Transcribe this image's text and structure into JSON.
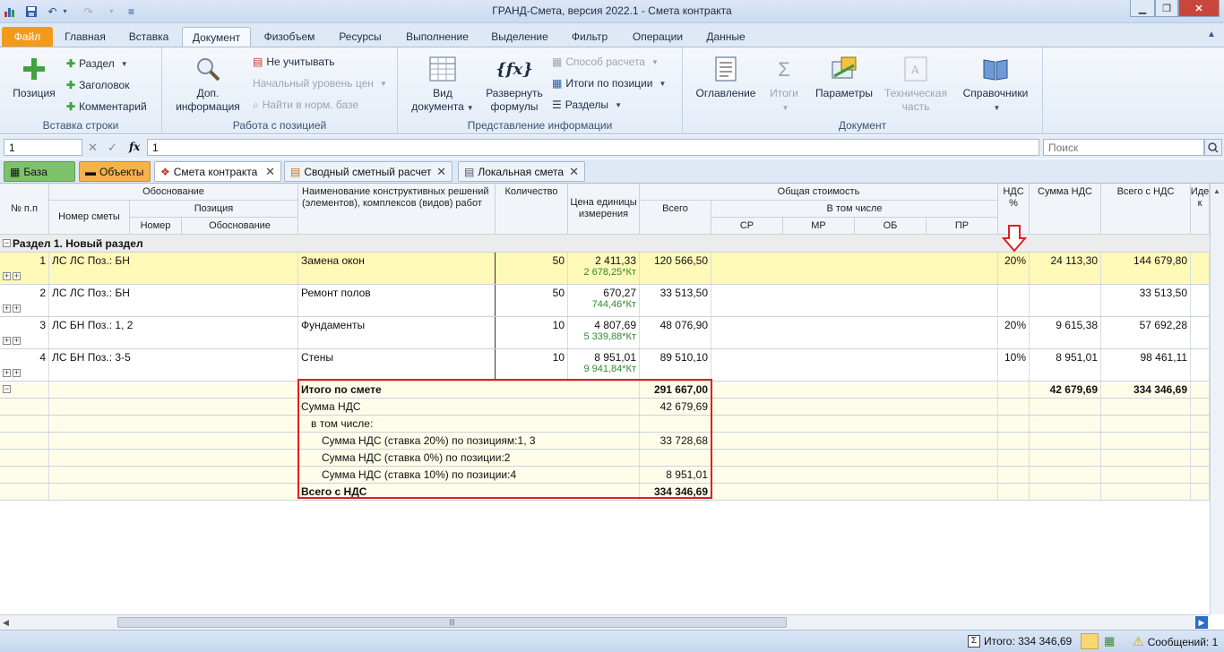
{
  "window": {
    "title": "ГРАНД-Смета, версия 2022.1 - Смета контракта"
  },
  "ribbon_tabs": [
    "Файл",
    "Главная",
    "Вставка",
    "Документ",
    "Физобъем",
    "Ресурсы",
    "Выполнение",
    "Выделение",
    "Фильтр",
    "Операции",
    "Данные"
  ],
  "ribbon": {
    "insert_row": {
      "label": "Вставка строки",
      "position": "Позиция",
      "section": "Раздел",
      "header": "Заголовок",
      "comment": "Комментарий"
    },
    "position_work": {
      "label": "Работа с позицией",
      "info": "Доп. информация",
      "ignore": "Не учитывать",
      "start_price": "Начальный уровень цен",
      "find_norm": "Найти в норм. базе"
    },
    "presentation": {
      "label": "Представление информации",
      "view": "Вид документа",
      "expand": "Развернуть формулы",
      "calc_method": "Способ расчета",
      "totals_pos": "Итоги по позиции",
      "sections": "Разделы"
    },
    "document": {
      "label": "Документ",
      "toc": "Оглавление",
      "totals": "Итоги",
      "params": "Параметры",
      "tech": "Техническая часть",
      "refs": "Справочники"
    }
  },
  "formula_bar": {
    "cell": "1",
    "fx": "fx",
    "value": "1",
    "search_placeholder": "Поиск"
  },
  "doc_tabs": [
    {
      "label": "База"
    },
    {
      "label": "Объекты"
    },
    {
      "label": "Смета контракта"
    },
    {
      "label": "Сводный сметный расчет"
    },
    {
      "label": "Локальная смета"
    }
  ],
  "headers": {
    "num": "№ п.п",
    "basis": "Обоснование",
    "est_num": "Номер сметы",
    "position": "Позиция",
    "pos_num": "Номер",
    "pos_basis": "Обоснование",
    "name": "Наименование конструктивных решений (элементов), комплексов (видов) работ",
    "qty": "Количество",
    "price": "Цена единицы измерения",
    "total_cost": "Общая стоимость",
    "total": "Всего",
    "incl": "В том числе",
    "sr": "СР",
    "mr": "МР",
    "ob": "ОБ",
    "pr": "ПР",
    "vat_pct": "НДС %",
    "vat_sum": "Сумма НДС",
    "total_vat": "Всего с НДС",
    "id": "Иде к"
  },
  "section_title": "Раздел 1. Новый раздел",
  "rows": [
    {
      "n": "1",
      "est": "ЛС ЛС Поз.: БН",
      "name": "Замена окон",
      "qty": "50",
      "price": "2 411,33",
      "price2": "2 678,25*Кт",
      "total": "120 566,50",
      "vat": "20%",
      "vat_sum": "24 113,30",
      "total_vat": "144 679,80"
    },
    {
      "n": "2",
      "est": "ЛС ЛС Поз.: БН",
      "name": "Ремонт полов",
      "qty": "50",
      "price": "670,27",
      "price2": "744,46*Кт",
      "total": "33 513,50",
      "vat": "",
      "vat_sum": "",
      "total_vat": "33 513,50"
    },
    {
      "n": "3",
      "est": "ЛС БН Поз.: 1, 2",
      "name": "Фундаменты",
      "qty": "10",
      "price": "4 807,69",
      "price2": "5 339,88*Кт",
      "total": "48 076,90",
      "vat": "20%",
      "vat_sum": "9 615,38",
      "total_vat": "57 692,28"
    },
    {
      "n": "4",
      "est": "ЛС БН Поз.: 3-5",
      "name": "Стены",
      "qty": "10",
      "price": "8 951,01",
      "price2": "9 941,84*Кт",
      "total": "89 510,10",
      "vat": "10%",
      "vat_sum": "8 951,01",
      "total_vat": "98 461,11"
    }
  ],
  "summary": [
    {
      "label": "Итого по смете",
      "value": "291 667,00",
      "bold": true,
      "vat_sum": "42 679,69",
      "total_vat": "334 346,69"
    },
    {
      "label": "Сумма НДС",
      "value": "42 679,69"
    },
    {
      "label": "в том числе:",
      "value": ""
    },
    {
      "label": "Сумма НДС (ставка 20%) по позициям:1, 3",
      "value": "33 728,68"
    },
    {
      "label": "Сумма НДС (ставка 0%) по позиции:2",
      "value": ""
    },
    {
      "label": "Сумма НДС (ставка 10%) по позиции:4",
      "value": "8 951,01"
    },
    {
      "label": "Всего с НДС",
      "value": "334 346,69",
      "bold": true
    }
  ],
  "status": {
    "total": "Итого: 334 346,69",
    "messages": "Сообщений: 1"
  },
  "colors": {
    "selected_row": "#fff9b8",
    "summary_bg": "#fffde9",
    "highlight_box": "#e02020",
    "arrow": "#e02020"
  }
}
